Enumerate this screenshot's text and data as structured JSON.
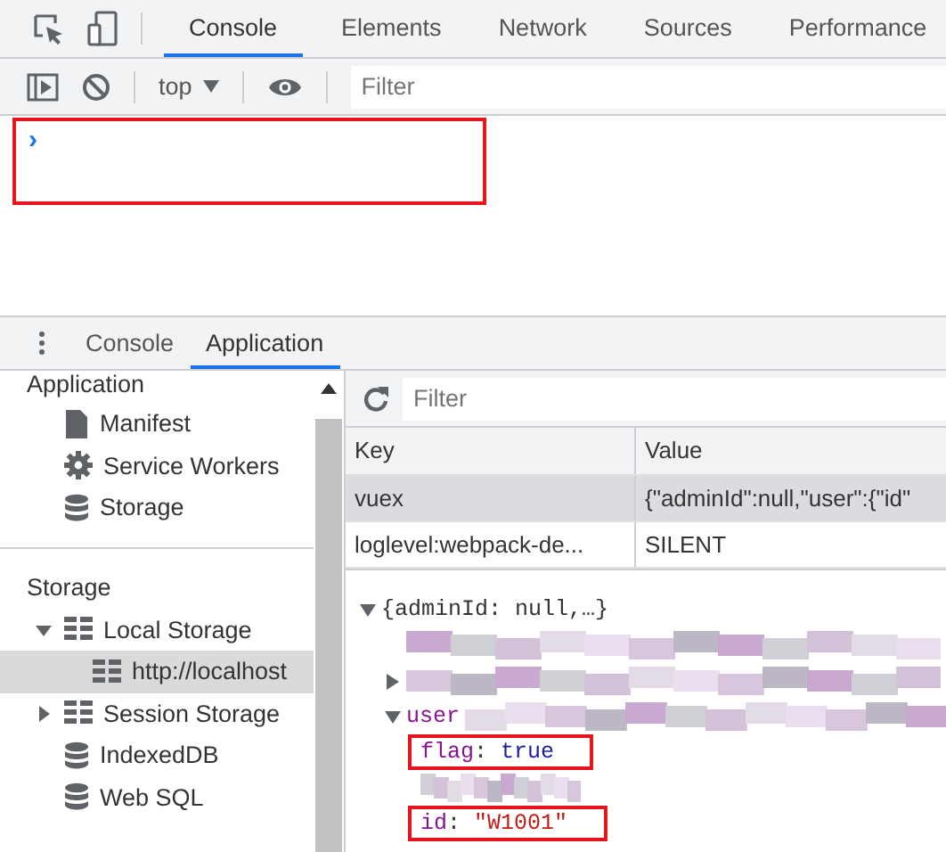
{
  "main_tabs": [
    {
      "label": "Console",
      "selected": true
    },
    {
      "label": "Elements",
      "selected": false
    },
    {
      "label": "Network",
      "selected": false
    },
    {
      "label": "Sources",
      "selected": false
    },
    {
      "label": "Performance",
      "selected": false
    }
  ],
  "console_toolbar": {
    "context": "top",
    "filter_placeholder": "Filter"
  },
  "console": {
    "prompt": "›",
    "highlighted": true
  },
  "drawer_tabs": [
    {
      "label": "Console",
      "selected": false
    },
    {
      "label": "Application",
      "selected": true
    }
  ],
  "sidebar": {
    "section_title": "Application",
    "items": [
      {
        "label": "Manifest",
        "kind": "file",
        "selected": false
      },
      {
        "label": "Service Workers",
        "kind": "gear",
        "selected": false
      },
      {
        "label": "Storage",
        "kind": "database",
        "selected": false
      }
    ],
    "storage_title": "Storage",
    "storage_items": [
      {
        "label": "Local Storage",
        "kind": "table",
        "selected": false,
        "expanded": true,
        "children": [
          {
            "label": "http://localhost",
            "kind": "table",
            "selected": true
          }
        ]
      },
      {
        "label": "Session Storage",
        "kind": "table",
        "selected": false,
        "expanded": false
      },
      {
        "label": "IndexedDB",
        "kind": "database",
        "selected": false
      },
      {
        "label": "Web SQL",
        "kind": "database",
        "selected": false
      }
    ]
  },
  "storage_panel": {
    "filter_placeholder": "Filter",
    "columns": [
      "Key",
      "Value"
    ],
    "rows": [
      {
        "key": "vuex",
        "value": "{\"adminId\":null,\"user\":{\"id\"",
        "selected": true
      },
      {
        "key": "loglevel:webpack-de...",
        "value": "SILENT",
        "selected": false
      }
    ],
    "preview": {
      "text": "{adminId: null,…}",
      "expanded": true,
      "children": [
        {
          "kind": "redacted"
        },
        {
          "kind": "redacted",
          "expanded": false
        },
        {
          "kind": "partial",
          "key": "user",
          "expanded": true,
          "children": [
            {
              "kind": "property",
              "key": "flag",
              "separator": ":",
              "value": "true",
              "color": "#1a1aa6",
              "highlighted": true
            },
            {
              "kind": "redacted"
            },
            {
              "kind": "property",
              "key": "id",
              "separator": ":",
              "value": "\"W1001\"",
              "color": "#c41a16",
              "highlighted": true
            }
          ]
        }
      ]
    }
  }
}
